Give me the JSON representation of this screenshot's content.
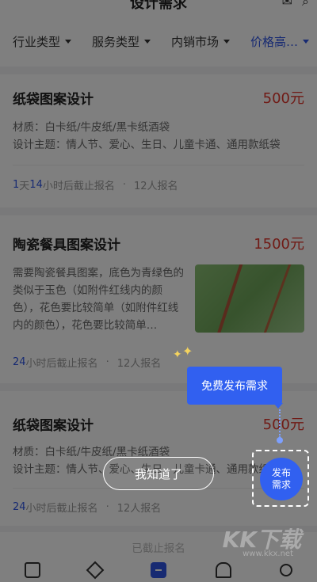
{
  "header": {
    "title": "设计需求",
    "icons": [
      "message-icon",
      "search-icon"
    ]
  },
  "filters": [
    {
      "label": "行业类型"
    },
    {
      "label": "服务类型"
    },
    {
      "label": "内销市场"
    },
    {
      "label": "价格高…"
    }
  ],
  "cards": [
    {
      "title": "纸袋图案设计",
      "price": "500元",
      "material": "材质：白卡纸/牛皮纸/黑卡纸酒袋",
      "theme": "设计主题：情人节、爱心、生日、儿童卡通、通用款纸袋",
      "deadline_num1": "1",
      "deadline_unit1": "天",
      "deadline_num2": "14",
      "deadline_tail": "小时后截止报名",
      "signups": "12人报名"
    },
    {
      "title": "陶瓷餐具图案设计",
      "price": "1500元",
      "desc": "需要陶瓷餐具图案，底色为青绿色的类似于玉色（如附件红线内的颜色），花色要比较简单（如附件红线内的颜色），花色要比较简单…",
      "deadline_num": "24",
      "deadline_tail": "小时后截止报名",
      "signups": "12人报名"
    },
    {
      "title": "纸袋图案设计",
      "price": "500元",
      "material": "材质：白卡纸/牛皮纸/黑卡纸酒袋",
      "theme": "设计主题：情人节、爱心、生日、儿童卡通、通用款纸袋",
      "deadline_num": "24",
      "deadline_tail": "小时后截止报名",
      "signups": "12人报名"
    }
  ],
  "guide": {
    "tip": "免费发布需求",
    "got_it": "我知道了",
    "publish_line1": "发布",
    "publish_line2": "需求"
  },
  "more_text": "已截止报名",
  "watermark": {
    "text": "KK下载",
    "url": "www.kkx.net"
  },
  "colors": {
    "accent": "#2f55e4",
    "price": "#e0362c"
  }
}
